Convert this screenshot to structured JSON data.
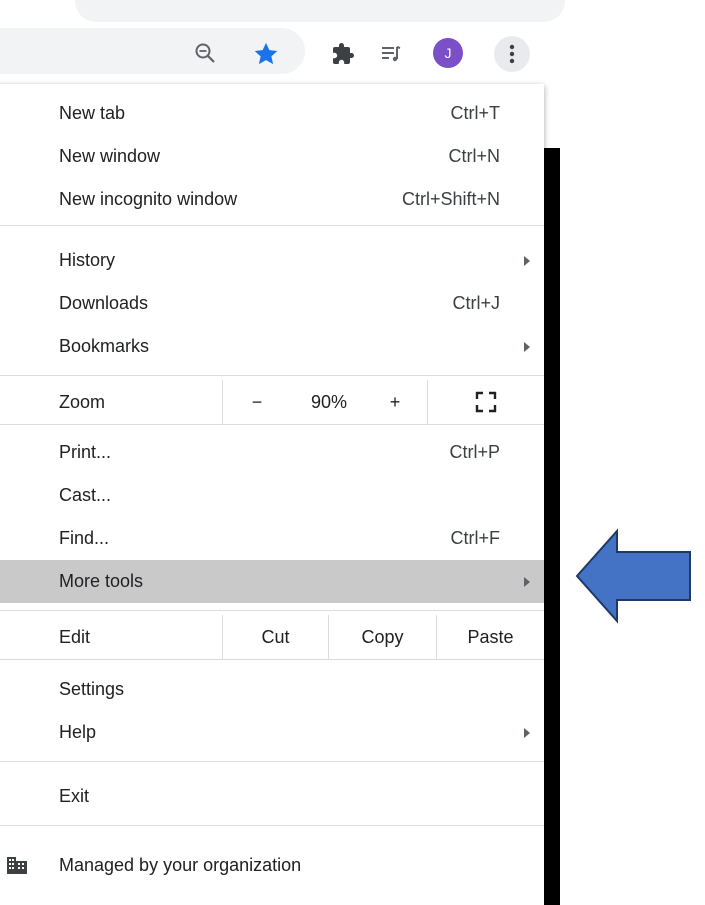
{
  "avatar_letter": "J",
  "menu": {
    "items": [
      {
        "label": "New tab",
        "accel": "Ctrl+T"
      },
      {
        "label": "New window",
        "accel": "Ctrl+N"
      },
      {
        "label": "New incognito window",
        "accel": "Ctrl+Shift+N"
      },
      {
        "label": "History",
        "accel": ""
      },
      {
        "label": "Downloads",
        "accel": "Ctrl+J"
      },
      {
        "label": "Bookmarks",
        "accel": ""
      },
      {
        "label": "Print...",
        "accel": "Ctrl+P"
      },
      {
        "label": "Cast...",
        "accel": ""
      },
      {
        "label": "Find...",
        "accel": "Ctrl+F"
      },
      {
        "label": "More tools",
        "accel": ""
      },
      {
        "label": "Settings",
        "accel": ""
      },
      {
        "label": "Help",
        "accel": ""
      },
      {
        "label": "Exit",
        "accel": ""
      }
    ],
    "zoom": {
      "label": "Zoom",
      "minus": "−",
      "value": "90%",
      "plus": "+"
    },
    "edit": {
      "label": "Edit",
      "cut": "Cut",
      "copy": "Copy",
      "paste": "Paste"
    },
    "managed": "Managed by your organization"
  },
  "colors": {
    "highlight": "#c9c9c9",
    "star": "#1a73e8",
    "avatar": "#7b4fc7",
    "arrow_fill": "#4472c4",
    "arrow_stroke": "#1f3864"
  }
}
